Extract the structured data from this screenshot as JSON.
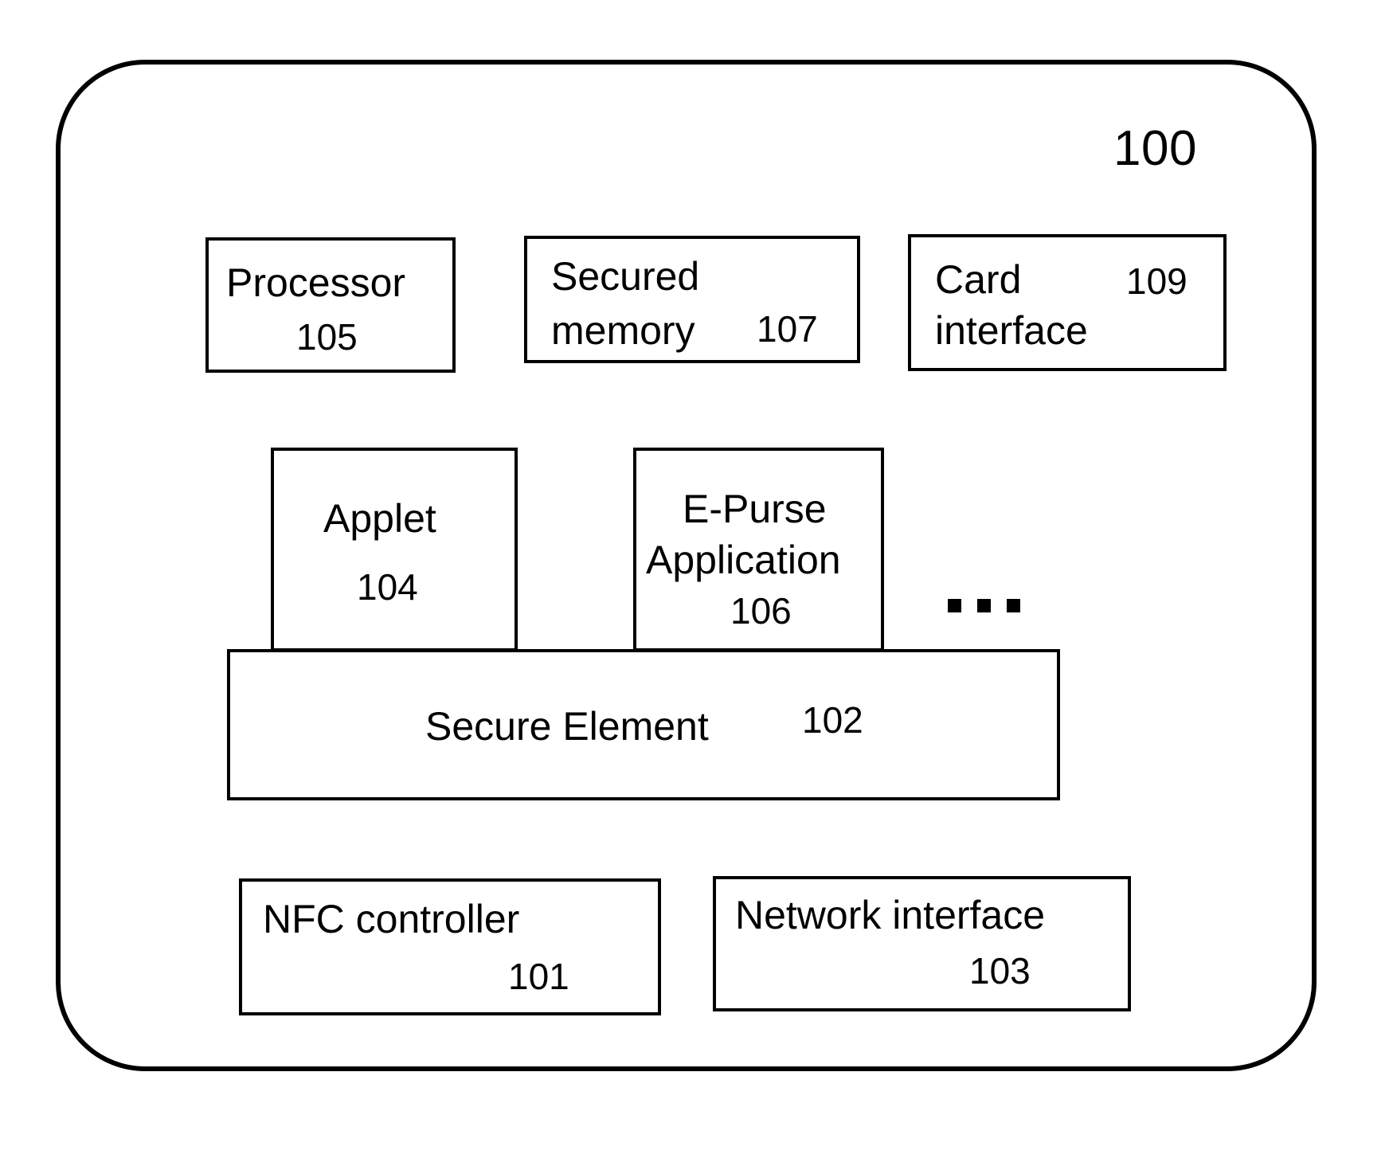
{
  "figure": {
    "device_ref": "100",
    "ellipsis_dots": 3
  },
  "blocks": {
    "processor": {
      "label": "Processor",
      "ref": "105"
    },
    "secured_memory": {
      "label_line1": "Secured",
      "label_line2": "memory",
      "ref": "107"
    },
    "card_interface": {
      "label_line1": "Card",
      "label_line2": "interface",
      "ref": "109"
    },
    "applet": {
      "label": "Applet",
      "ref": "104"
    },
    "epurse_application": {
      "label_line1": "E-Purse",
      "label_line2": "Application",
      "ref": "106"
    },
    "secure_element": {
      "label": "Secure Element",
      "ref": "102"
    },
    "nfc_controller": {
      "label": "NFC controller",
      "ref": "101"
    },
    "network_interface": {
      "label": "Network interface",
      "ref": "103"
    }
  },
  "colors": {
    "stroke": "#000000",
    "fill": "#ffffff"
  }
}
